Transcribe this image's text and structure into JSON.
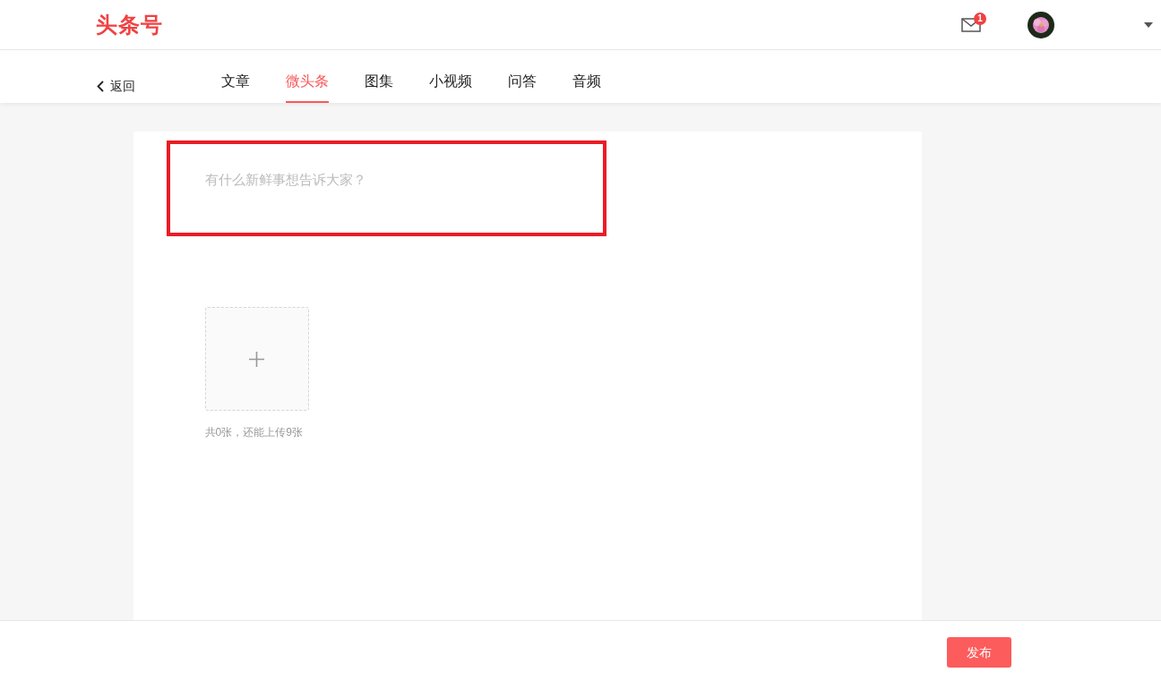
{
  "header": {
    "logo": "头条号",
    "mail_badge": "1"
  },
  "nav": {
    "back": "返回",
    "tabs": [
      {
        "label": "文章",
        "selected": false
      },
      {
        "label": "微头条",
        "selected": true
      },
      {
        "label": "图集",
        "selected": false
      },
      {
        "label": "小视频",
        "selected": false
      },
      {
        "label": "问答",
        "selected": false
      },
      {
        "label": "音频",
        "selected": false
      }
    ]
  },
  "editor": {
    "placeholder": "有什么新鲜事想告诉大家？",
    "highlighted": true
  },
  "upload": {
    "caption": "共0张，还能上传9张"
  },
  "footer": {
    "publish": "发布"
  }
}
